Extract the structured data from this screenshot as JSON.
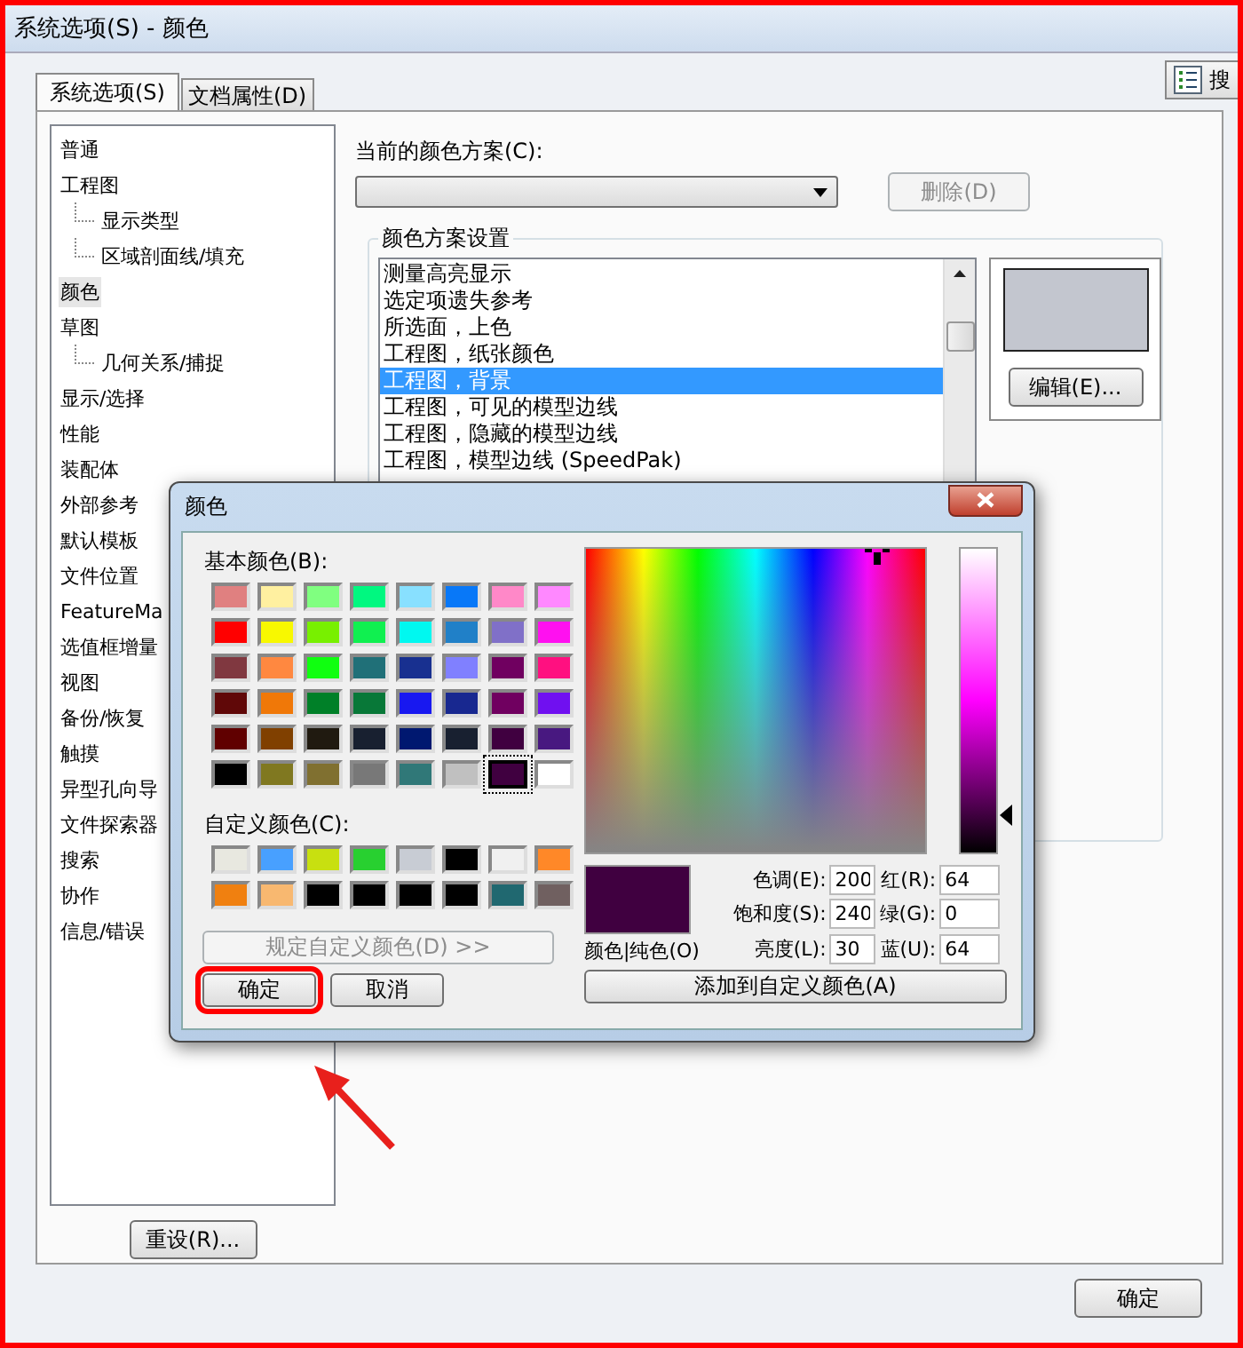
{
  "window": {
    "title": "系统选项(S) - 颜色"
  },
  "tabs": [
    {
      "label": "系统选项(S)",
      "selected": true
    },
    {
      "label": "文档属性(D)",
      "selected": false
    }
  ],
  "search_button": {
    "label": "搜"
  },
  "tree": [
    {
      "label": "普通",
      "selected": false
    },
    {
      "label": "工程图",
      "selected": false,
      "children": [
        {
          "label": "显示类型",
          "selected": false
        },
        {
          "label": "区域剖面线/填充",
          "selected": false
        }
      ]
    },
    {
      "label": "颜色",
      "selected": true
    },
    {
      "label": "草图",
      "selected": false,
      "children": [
        {
          "label": "几何关系/捕捉",
          "selected": false
        }
      ]
    },
    {
      "label": "显示/选择",
      "selected": false
    },
    {
      "label": "性能",
      "selected": false
    },
    {
      "label": "装配体",
      "selected": false
    },
    {
      "label": "外部参考",
      "selected": false
    },
    {
      "label": "默认模板",
      "selected": false
    },
    {
      "label": "文件位置",
      "selected": false
    },
    {
      "label": "FeatureMa",
      "selected": false
    },
    {
      "label": "选值框增量",
      "selected": false
    },
    {
      "label": "视图",
      "selected": false
    },
    {
      "label": "备份/恢复",
      "selected": false
    },
    {
      "label": "触摸",
      "selected": false
    },
    {
      "label": "异型孔向导",
      "selected": false
    },
    {
      "label": "文件探索器",
      "selected": false
    },
    {
      "label": "搜索",
      "selected": false
    },
    {
      "label": "协作",
      "selected": false
    },
    {
      "label": "信息/错误",
      "selected": false
    }
  ],
  "reset_button": "重设(R)...",
  "scheme": {
    "label": "当前的颜色方案(C):",
    "delete_button": "删除(D)",
    "delete_disabled": true
  },
  "scheme_settings": {
    "title": "颜色方案设置",
    "items": [
      {
        "label": "测量高亮显示",
        "selected": false
      },
      {
        "label": "选定项遗失参考",
        "selected": false
      },
      {
        "label": "所选面，上色",
        "selected": false
      },
      {
        "label": "工程图，纸张颜色",
        "selected": false
      },
      {
        "label": "工程图，背景",
        "selected": true
      },
      {
        "label": "工程图，可见的模型边线",
        "selected": false
      },
      {
        "label": "工程图，隐藏的模型边线",
        "selected": false
      },
      {
        "label": "工程图，模型边线 (SpeedPak)",
        "selected": false
      }
    ],
    "preview": {
      "color": "#c3c6cf"
    },
    "edit_button": "编辑(E)..."
  },
  "ok_button": "确定",
  "color_dialog": {
    "title": "颜色",
    "basic_label": "基本颜色(B):",
    "basic_colors": [
      {
        "color": "#e08080",
        "selected": false
      },
      {
        "color": "#fff0a0",
        "selected": false
      },
      {
        "color": "#80ff80",
        "selected": false
      },
      {
        "color": "#00f880",
        "selected": false
      },
      {
        "color": "#88e0ff",
        "selected": false
      },
      {
        "color": "#0878f8",
        "selected": false
      },
      {
        "color": "#ff88c8",
        "selected": false
      },
      {
        "color": "#ff88ff",
        "selected": false
      },
      {
        "color": "#ff0000",
        "selected": false
      },
      {
        "color": "#f8f800",
        "selected": false
      },
      {
        "color": "#78f000",
        "selected": false
      },
      {
        "color": "#10f050",
        "selected": false
      },
      {
        "color": "#00f8f0",
        "selected": false
      },
      {
        "color": "#2080c8",
        "selected": false
      },
      {
        "color": "#8070c8",
        "selected": false
      },
      {
        "color": "#ff10f0",
        "selected": false
      },
      {
        "color": "#803840",
        "selected": false
      },
      {
        "color": "#ff8840",
        "selected": false
      },
      {
        "color": "#10ff10",
        "selected": false
      },
      {
        "color": "#207078",
        "selected": false
      },
      {
        "color": "#183090",
        "selected": false
      },
      {
        "color": "#8080ff",
        "selected": false
      },
      {
        "color": "#700060",
        "selected": false
      },
      {
        "color": "#ff1080",
        "selected": false
      },
      {
        "color": "#600808",
        "selected": false
      },
      {
        "color": "#f07808",
        "selected": false
      },
      {
        "color": "#008028",
        "selected": false
      },
      {
        "color": "#087838",
        "selected": false
      },
      {
        "color": "#1818f0",
        "selected": false
      },
      {
        "color": "#182890",
        "selected": false
      },
      {
        "color": "#700060",
        "selected": false
      },
      {
        "color": "#7010f0",
        "selected": false
      },
      {
        "color": "#600000",
        "selected": false
      },
      {
        "color": "#804000",
        "selected": false
      },
      {
        "color": "#201a10",
        "selected": false
      },
      {
        "color": "#182030",
        "selected": false
      },
      {
        "color": "#001870",
        "selected": false
      },
      {
        "color": "#182030",
        "selected": false
      },
      {
        "color": "#400040",
        "selected": false
      },
      {
        "color": "#481880",
        "selected": false
      },
      {
        "color": "#000000",
        "selected": false
      },
      {
        "color": "#807820",
        "selected": false
      },
      {
        "color": "#807030",
        "selected": false
      },
      {
        "color": "#787878",
        "selected": false
      },
      {
        "color": "#307878",
        "selected": false
      },
      {
        "color": "#c0c0c0",
        "selected": false
      },
      {
        "color": "#400040",
        "selected": true
      },
      {
        "color": "#ffffff",
        "selected": false
      }
    ],
    "custom_label": "自定义颜色(C):",
    "custom_colors": [
      {
        "color": "#e8e8e0"
      },
      {
        "color": "#48a0ff"
      },
      {
        "color": "#c8e010"
      },
      {
        "color": "#28d030"
      },
      {
        "color": "#c8ccd4"
      },
      {
        "color": "#000000"
      },
      {
        "color": "#f0f0f0"
      },
      {
        "color": "#ff8828"
      },
      {
        "color": "#f08010"
      },
      {
        "color": "#f8b870"
      },
      {
        "color": "#000000"
      },
      {
        "color": "#000000"
      },
      {
        "color": "#000000"
      },
      {
        "color": "#000000"
      },
      {
        "color": "#206870"
      },
      {
        "color": "#706060"
      }
    ],
    "define_button": {
      "label": "规定自定义颜色(D) >>",
      "disabled": true
    },
    "ok_button": {
      "label": "确定",
      "highlighted": true
    },
    "cancel_button": "取消",
    "luminance": {
      "level": 0.125
    },
    "current": {
      "color": "#400040",
      "label": "颜色|纯色(O)"
    },
    "fields": [
      {
        "label": "色调(E):",
        "value": "200"
      },
      {
        "label": "红(R):",
        "value": "64"
      },
      {
        "label": "饱和度(S):",
        "value": "240"
      },
      {
        "label": "绿(G):",
        "value": "0"
      },
      {
        "label": "亮度(L):",
        "value": "30"
      },
      {
        "label": "蓝(U):",
        "value": "64"
      }
    ],
    "add_button": "添加到自定义颜色(A)"
  },
  "pointer_arrow": true
}
